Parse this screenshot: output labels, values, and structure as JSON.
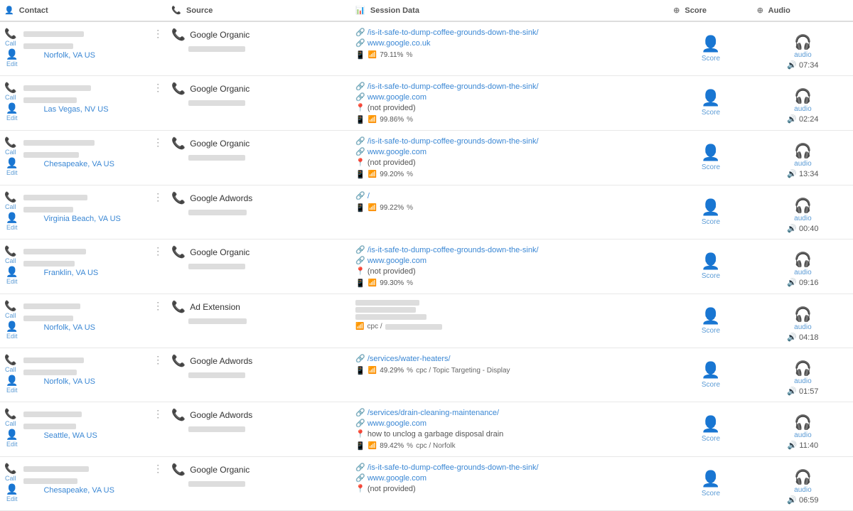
{
  "columns": {
    "contact": "Contact",
    "source": "Source",
    "session": "Session Data",
    "score": "Score",
    "audio": "Audio"
  },
  "rows": [
    {
      "id": 1,
      "contact": {
        "name_width": 85,
        "phone_width": 70,
        "location": "Norfolk, VA US"
      },
      "source": {
        "type": "Google Organic",
        "phone_width": 80
      },
      "session": {
        "link": "/is-it-safe-to-dump-coffee-grounds-down-the-sink/",
        "ref": "www.google.co.uk",
        "keyword": "",
        "score_pct": "79.11%",
        "has_mobile": true
      },
      "score_label": "Score",
      "audio": {
        "label": "audio",
        "time": "07:34"
      }
    },
    {
      "id": 2,
      "contact": {
        "name_width": 95,
        "phone_width": 75,
        "location": "Las Vegas, NV US"
      },
      "source": {
        "type": "Google Organic",
        "phone_width": 80
      },
      "session": {
        "link": "/is-it-safe-to-dump-coffee-grounds-down-the-sink/",
        "ref": "www.google.com",
        "keyword": "(not provided)",
        "score_pct": "99.86%",
        "has_mobile": true
      },
      "score_label": "Score",
      "audio": {
        "label": "audio",
        "time": "02:24"
      }
    },
    {
      "id": 3,
      "contact": {
        "name_width": 100,
        "phone_width": 78,
        "location": "Chesapeake, VA US"
      },
      "source": {
        "type": "Google Organic",
        "phone_width": 80
      },
      "session": {
        "link": "/is-it-safe-to-dump-coffee-grounds-down-the-sink/",
        "ref": "www.google.com",
        "keyword": "(not provided)",
        "score_pct": "99.20%",
        "has_mobile": true
      },
      "score_label": "Score",
      "audio": {
        "label": "audio",
        "time": "13:34"
      }
    },
    {
      "id": 4,
      "contact": {
        "name_width": 90,
        "phone_width": 70,
        "location": "Virginia Beach, VA US"
      },
      "source": {
        "type": "Google Adwords",
        "phone_width": 82
      },
      "session": {
        "link": "/",
        "ref": "",
        "keyword": "",
        "score_pct": "99.22%",
        "has_mobile": true
      },
      "score_label": "Score",
      "audio": {
        "label": "audio",
        "time": "00:40"
      }
    },
    {
      "id": 5,
      "contact": {
        "name_width": 88,
        "phone_width": 72,
        "location": "Franklin, VA US"
      },
      "source": {
        "type": "Google Organic",
        "phone_width": 80
      },
      "session": {
        "link": "/is-it-safe-to-dump-coffee-grounds-down-the-sink/",
        "ref": "www.google.com",
        "keyword": "(not provided)",
        "score_pct": "99.30%",
        "has_mobile": true
      },
      "score_label": "Score",
      "audio": {
        "label": "audio",
        "time": "09:16"
      }
    },
    {
      "id": 6,
      "contact": {
        "name_width": 80,
        "phone_width": 70,
        "location": "Norfolk, VA US"
      },
      "source": {
        "type": "Ad Extension",
        "phone_width": 82
      },
      "session": {
        "link": "",
        "ref": "",
        "keyword": "",
        "score_pct": "",
        "blurred1_width": 90,
        "blurred2_width": 85,
        "blurred3_width": 100,
        "cpc": "cpc /",
        "cpc_detail_width": 80,
        "has_mobile": false
      },
      "score_label": "Score",
      "audio": {
        "label": "audio",
        "time": "04:18"
      }
    },
    {
      "id": 7,
      "contact": {
        "name_width": 85,
        "phone_width": 75,
        "location": "Norfolk, VA US"
      },
      "source": {
        "type": "Google Adwords",
        "phone_width": 80
      },
      "session": {
        "link": "/services/water-heaters/",
        "ref": "",
        "keyword": "",
        "score_pct": "49.29%",
        "cpc": "cpc / Topic Targeting - Display",
        "has_mobile": true
      },
      "score_label": "Score",
      "audio": {
        "label": "audio",
        "time": "01:57"
      }
    },
    {
      "id": 8,
      "contact": {
        "name_width": 82,
        "phone_width": 74,
        "location": "Seattle, WA US"
      },
      "source": {
        "type": "Google Adwords",
        "phone_width": 80
      },
      "session": {
        "link": "/services/drain-cleaning-maintenance/",
        "ref": "www.google.com",
        "keyword": "how to unclog a garbage disposal drain",
        "score_pct": "89.42%",
        "cpc": "cpc / Norfolk",
        "has_mobile": true
      },
      "score_label": "Score",
      "audio": {
        "label": "audio",
        "time": "11:40"
      }
    },
    {
      "id": 9,
      "contact": {
        "name_width": 92,
        "phone_width": 76,
        "location": "Chesapeake, VA US"
      },
      "source": {
        "type": "Google Organic",
        "phone_width": 80
      },
      "session": {
        "link": "/is-it-safe-to-dump-coffee-grounds-down-the-sink/",
        "ref": "www.google.com",
        "keyword": "(not provided)",
        "score_pct": "",
        "has_mobile": false
      },
      "score_label": "Score",
      "audio": {
        "label": "audio",
        "time": "06:59"
      }
    }
  ]
}
